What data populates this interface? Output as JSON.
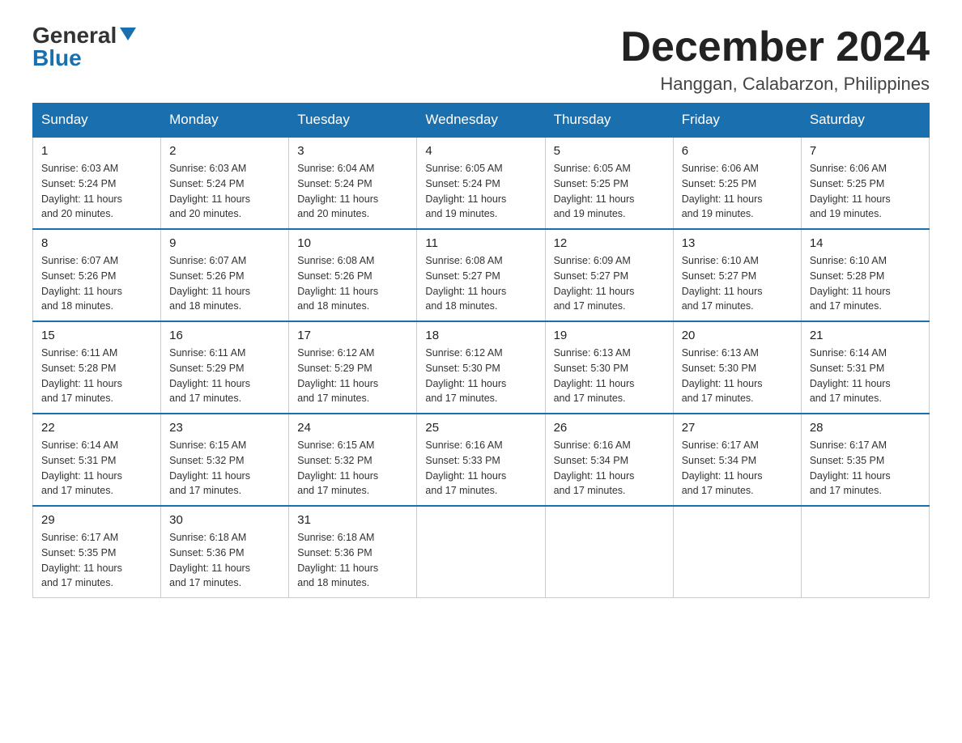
{
  "logo": {
    "general": "General",
    "blue": "Blue"
  },
  "title": "December 2024",
  "subtitle": "Hanggan, Calabarzon, Philippines",
  "days_of_week": [
    "Sunday",
    "Monday",
    "Tuesday",
    "Wednesday",
    "Thursday",
    "Friday",
    "Saturday"
  ],
  "weeks": [
    [
      {
        "day": "1",
        "sunrise": "6:03 AM",
        "sunset": "5:24 PM",
        "daylight": "11 hours and 20 minutes."
      },
      {
        "day": "2",
        "sunrise": "6:03 AM",
        "sunset": "5:24 PM",
        "daylight": "11 hours and 20 minutes."
      },
      {
        "day": "3",
        "sunrise": "6:04 AM",
        "sunset": "5:24 PM",
        "daylight": "11 hours and 20 minutes."
      },
      {
        "day": "4",
        "sunrise": "6:05 AM",
        "sunset": "5:24 PM",
        "daylight": "11 hours and 19 minutes."
      },
      {
        "day": "5",
        "sunrise": "6:05 AM",
        "sunset": "5:25 PM",
        "daylight": "11 hours and 19 minutes."
      },
      {
        "day": "6",
        "sunrise": "6:06 AM",
        "sunset": "5:25 PM",
        "daylight": "11 hours and 19 minutes."
      },
      {
        "day": "7",
        "sunrise": "6:06 AM",
        "sunset": "5:25 PM",
        "daylight": "11 hours and 19 minutes."
      }
    ],
    [
      {
        "day": "8",
        "sunrise": "6:07 AM",
        "sunset": "5:26 PM",
        "daylight": "11 hours and 18 minutes."
      },
      {
        "day": "9",
        "sunrise": "6:07 AM",
        "sunset": "5:26 PM",
        "daylight": "11 hours and 18 minutes."
      },
      {
        "day": "10",
        "sunrise": "6:08 AM",
        "sunset": "5:26 PM",
        "daylight": "11 hours and 18 minutes."
      },
      {
        "day": "11",
        "sunrise": "6:08 AM",
        "sunset": "5:27 PM",
        "daylight": "11 hours and 18 minutes."
      },
      {
        "day": "12",
        "sunrise": "6:09 AM",
        "sunset": "5:27 PM",
        "daylight": "11 hours and 17 minutes."
      },
      {
        "day": "13",
        "sunrise": "6:10 AM",
        "sunset": "5:27 PM",
        "daylight": "11 hours and 17 minutes."
      },
      {
        "day": "14",
        "sunrise": "6:10 AM",
        "sunset": "5:28 PM",
        "daylight": "11 hours and 17 minutes."
      }
    ],
    [
      {
        "day": "15",
        "sunrise": "6:11 AM",
        "sunset": "5:28 PM",
        "daylight": "11 hours and 17 minutes."
      },
      {
        "day": "16",
        "sunrise": "6:11 AM",
        "sunset": "5:29 PM",
        "daylight": "11 hours and 17 minutes."
      },
      {
        "day": "17",
        "sunrise": "6:12 AM",
        "sunset": "5:29 PM",
        "daylight": "11 hours and 17 minutes."
      },
      {
        "day": "18",
        "sunrise": "6:12 AM",
        "sunset": "5:30 PM",
        "daylight": "11 hours and 17 minutes."
      },
      {
        "day": "19",
        "sunrise": "6:13 AM",
        "sunset": "5:30 PM",
        "daylight": "11 hours and 17 minutes."
      },
      {
        "day": "20",
        "sunrise": "6:13 AM",
        "sunset": "5:30 PM",
        "daylight": "11 hours and 17 minutes."
      },
      {
        "day": "21",
        "sunrise": "6:14 AM",
        "sunset": "5:31 PM",
        "daylight": "11 hours and 17 minutes."
      }
    ],
    [
      {
        "day": "22",
        "sunrise": "6:14 AM",
        "sunset": "5:31 PM",
        "daylight": "11 hours and 17 minutes."
      },
      {
        "day": "23",
        "sunrise": "6:15 AM",
        "sunset": "5:32 PM",
        "daylight": "11 hours and 17 minutes."
      },
      {
        "day": "24",
        "sunrise": "6:15 AM",
        "sunset": "5:32 PM",
        "daylight": "11 hours and 17 minutes."
      },
      {
        "day": "25",
        "sunrise": "6:16 AM",
        "sunset": "5:33 PM",
        "daylight": "11 hours and 17 minutes."
      },
      {
        "day": "26",
        "sunrise": "6:16 AM",
        "sunset": "5:34 PM",
        "daylight": "11 hours and 17 minutes."
      },
      {
        "day": "27",
        "sunrise": "6:17 AM",
        "sunset": "5:34 PM",
        "daylight": "11 hours and 17 minutes."
      },
      {
        "day": "28",
        "sunrise": "6:17 AM",
        "sunset": "5:35 PM",
        "daylight": "11 hours and 17 minutes."
      }
    ],
    [
      {
        "day": "29",
        "sunrise": "6:17 AM",
        "sunset": "5:35 PM",
        "daylight": "11 hours and 17 minutes."
      },
      {
        "day": "30",
        "sunrise": "6:18 AM",
        "sunset": "5:36 PM",
        "daylight": "11 hours and 17 minutes."
      },
      {
        "day": "31",
        "sunrise": "6:18 AM",
        "sunset": "5:36 PM",
        "daylight": "11 hours and 18 minutes."
      },
      null,
      null,
      null,
      null
    ]
  ]
}
